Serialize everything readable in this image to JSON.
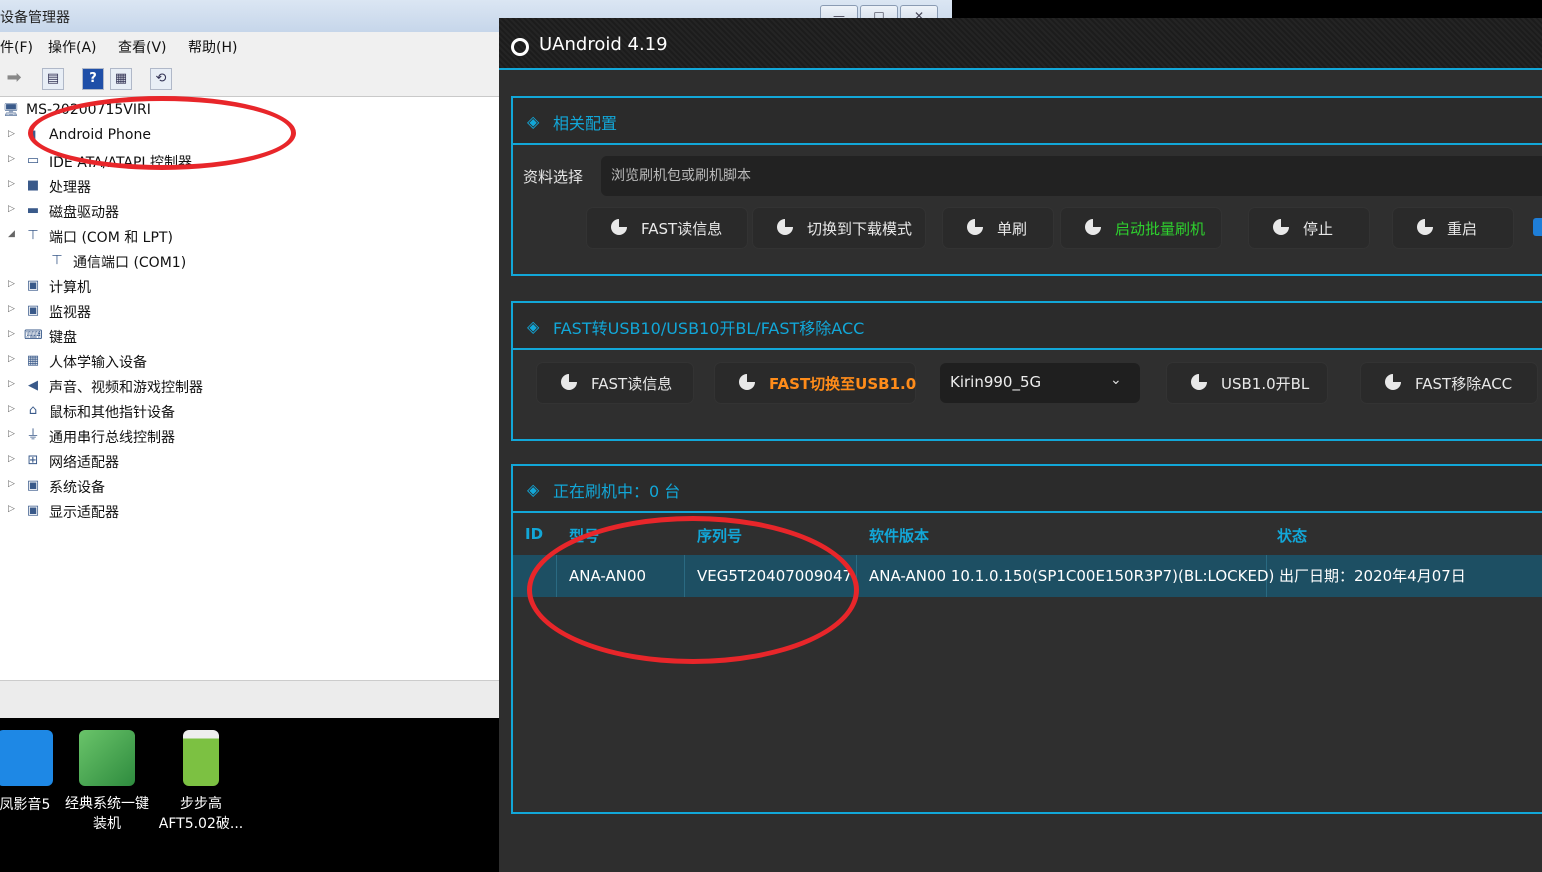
{
  "device_manager": {
    "title": "设备管理器",
    "window_buttons": [
      "—",
      "□",
      "✕"
    ],
    "menu": [
      "件(F)",
      "操作(A)",
      "查看(V)",
      "帮助(H)"
    ],
    "toolbar_icons": [
      "forward-arrow-icon",
      "properties-icon",
      "help-icon",
      "view-icon",
      "scan-hardware-icon"
    ],
    "root": "MS-20200715VIRI",
    "tree": [
      {
        "label": "Android Phone",
        "icon": "phone-icon",
        "expanded": false
      },
      {
        "label": "IDE ATA/ATAPI 控制器",
        "icon": "ide-controller-icon",
        "expanded": false
      },
      {
        "label": "处理器",
        "icon": "cpu-icon",
        "expanded": false
      },
      {
        "label": "磁盘驱动器",
        "icon": "disk-icon",
        "expanded": false
      },
      {
        "label": "端口 (COM 和 LPT)",
        "icon": "port-icon",
        "expanded": true
      },
      {
        "label": "通信端口 (COM1)",
        "icon": "port-icon",
        "child": true
      },
      {
        "label": "计算机",
        "icon": "computer-icon",
        "expanded": false
      },
      {
        "label": "监视器",
        "icon": "monitor-icon",
        "expanded": false
      },
      {
        "label": "键盘",
        "icon": "keyboard-icon",
        "expanded": false
      },
      {
        "label": "人体学输入设备",
        "icon": "hid-icon",
        "expanded": false
      },
      {
        "label": "声音、视频和游戏控制器",
        "icon": "sound-icon",
        "expanded": false
      },
      {
        "label": "鼠标和其他指针设备",
        "icon": "mouse-icon",
        "expanded": false
      },
      {
        "label": "通用串行总线控制器",
        "icon": "usb-icon",
        "expanded": false
      },
      {
        "label": "网络适配器",
        "icon": "network-icon",
        "expanded": false
      },
      {
        "label": "系统设备",
        "icon": "system-icon",
        "expanded": false
      },
      {
        "label": "显示适配器",
        "icon": "display-icon",
        "expanded": false
      }
    ]
  },
  "desktop": {
    "icons": [
      {
        "label1": "凤影音5",
        "label2": ""
      },
      {
        "label1": "经典系统一键",
        "label2": "装机"
      },
      {
        "label1": "步步高",
        "label2": "AFT5.02破..."
      }
    ]
  },
  "uandroid": {
    "title": "UAndroid 4.19",
    "config_panel": {
      "title": "相关配置",
      "file_label": "资料选择",
      "file_placeholder": "浏览刷机包或刷机脚本",
      "buttons": [
        "FAST读信息",
        "切换到下载模式",
        "单刷",
        "启动批量刷机",
        "停止",
        "重启"
      ]
    },
    "fast_panel": {
      "title": "FAST转USB10/USB10开BL/FAST移除ACC",
      "buttons": [
        "FAST读信息",
        "FAST切换至USB1.0",
        "USB1.0开BL",
        "FAST移除ACC"
      ],
      "chip_selected": "Kirin990_5G"
    },
    "flashing_panel": {
      "title": "正在刷机中：0 台",
      "columns": [
        "ID",
        "型号",
        "序列号",
        "软件版本",
        "状态"
      ],
      "rows": [
        {
          "id": "",
          "model": "ANA-AN00",
          "serial": "VEG5T20407009047",
          "version": "ANA-AN00 10.1.0.150(SP1C00E150R3P7)(BL:LOCKED)",
          "status": "出厂日期：2020年4月07日"
        }
      ]
    },
    "colors": {
      "accent": "#12a7d8",
      "highlight_green": "#2ed12e",
      "highlight_orange": "#ff8c1a",
      "annotation_red": "#e8262a"
    }
  }
}
